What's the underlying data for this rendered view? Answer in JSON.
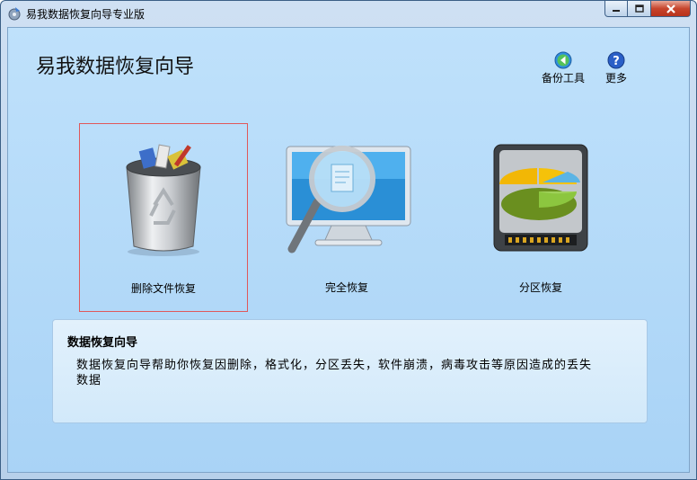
{
  "window": {
    "title": "易我数据恢复向导专业版"
  },
  "header": {
    "title": "易我数据恢复向导"
  },
  "tools": {
    "backup_label": "备份工具",
    "more_label": "更多"
  },
  "options": [
    {
      "label": "删除文件恢复",
      "selected": true,
      "icon": "recycle-bin-icon"
    },
    {
      "label": "完全恢复",
      "selected": false,
      "icon": "monitor-magnifier-icon"
    },
    {
      "label": "分区恢复",
      "selected": false,
      "icon": "hard-drive-pie-icon"
    }
  ],
  "description": {
    "title": "数据恢复向导",
    "text": "数据恢复向导帮助你恢复因删除，格式化，分区丢失，软件崩溃，病毒攻击等原因造成的丢失数据"
  },
  "colors": {
    "selection_border": "#e0585a",
    "accent_blue": "#2f6fd0",
    "close_red": "#c7452d"
  }
}
